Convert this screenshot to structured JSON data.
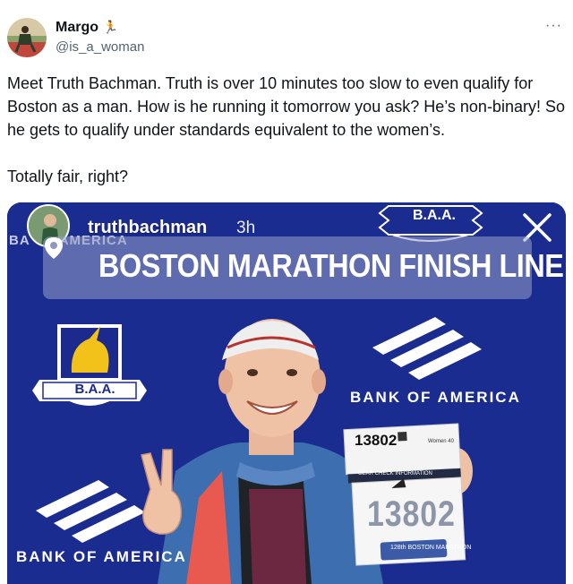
{
  "author": {
    "display_name": "Margo",
    "name_emoji": "🏃",
    "handle": "@is_a_woman",
    "more_icon": "ellipsis-icon"
  },
  "tweet": {
    "paragraph_1": "Meet Truth Bachman. Truth is over 10 minutes too slow to even qualify for Boston as a man. How is he running it tomorrow you ask? He’s non-binary! So he gets to qualify under standards equivalent to the women’s.",
    "paragraph_2": "Totally fair, right?"
  },
  "story": {
    "username": "truthbachman",
    "time_ago": "3h",
    "location_sticker": "BOSTON MARATHON FINISH LINE",
    "baa_logo_text": "B.A.A.",
    "sponsor_text": "BANK OF AMERICA",
    "faded_sponsor_text": "BA   OF AMERICA",
    "bib_number": "13802",
    "bib_small_label": "Women 40",
    "bib_check_text": "GEAR CHECK INFORMATION",
    "bib_footer": "128th BOSTON MARATHON"
  },
  "colors": {
    "backdrop_blue": "#1b2a8c",
    "handle_gray": "#536471",
    "text_black": "#0f1419"
  }
}
